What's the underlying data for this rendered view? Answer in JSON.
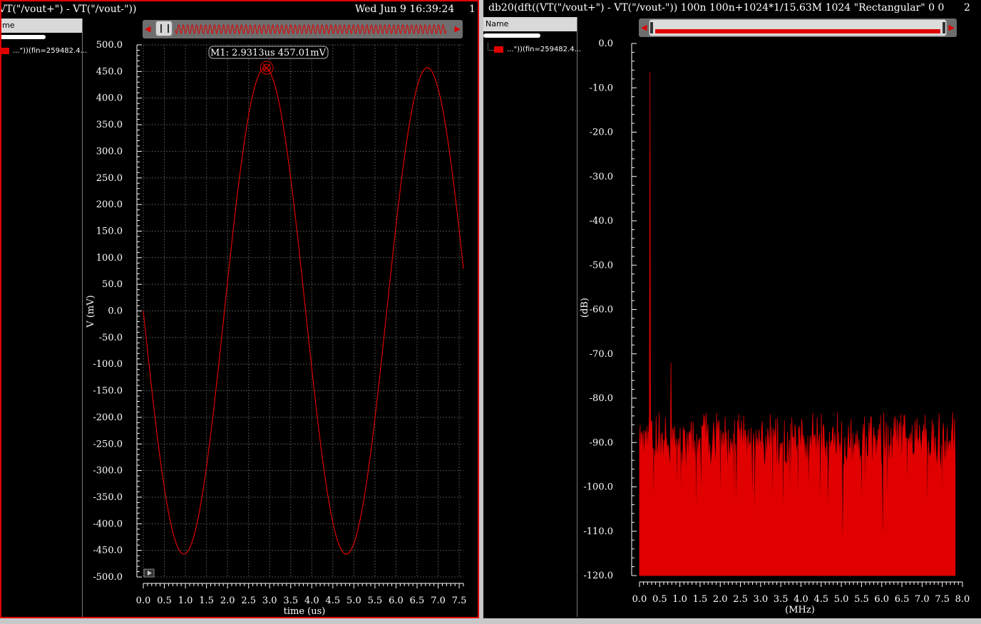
{
  "colors": {
    "trace": "#e00000",
    "grid": "#4a4a4a",
    "background": "#000000",
    "axis": "#ffffff"
  },
  "panel1": {
    "title": "VT(\"/vout+\") - VT(\"/vout-\"))",
    "date": "Wed Jun 9 16:39:24",
    "number": "1",
    "legend_header": "me",
    "legend_entry": "...\"))(fin=259482.4...",
    "marker_label": "M1: 2.9313us 457.01mV",
    "marker": {
      "x": 2.9313,
      "y": 457.01
    },
    "xlabel": "time (us)",
    "ylabel": "V (mV)"
  },
  "panel2": {
    "title": "db20(dft((VT(\"/vout+\") - VT(\"/vout-\"))  100n 100n+1024*1/15.63M 1024 \"Rectangular\" 0 0",
    "number": "2",
    "legend_header": "Name",
    "legend_entry": "...\"))(fin=259482.4...",
    "xlabel": "(MHz)",
    "ylabel": "(dB)"
  },
  "chart_data": [
    {
      "type": "line",
      "xlabel": "time (us)",
      "ylabel": "V (mV)",
      "xlim": [
        0,
        7.6
      ],
      "ylim": [
        -500,
        500
      ],
      "xticks": [
        "0.0",
        "0.5",
        "1.0",
        "1.5",
        "2.0",
        "2.5",
        "3.0",
        "3.5",
        "4.0",
        "4.5",
        "5.0",
        "5.5",
        "6.0",
        "6.5",
        "7.0",
        "7.5"
      ],
      "yticks": [
        "500.0",
        "450.0",
        "400.0",
        "350.0",
        "300.0",
        "250.0",
        "200.0",
        "150.0",
        "100.0",
        "50.0",
        "0.0",
        "-50.0",
        "-100.0",
        "-150.0",
        "-200.0",
        "-250.0",
        "-300.0",
        "-350.0",
        "-400.0",
        "-450.0",
        "-500.0"
      ],
      "grid": true,
      "series": [
        {
          "name": "...\"))(fin=259482.4...",
          "x": [
            0,
            0.964,
            2.93,
            4.86,
            6.78,
            7.6
          ],
          "y": [
            0,
            -457,
            457,
            -457,
            457,
            165
          ],
          "amplitude": 457,
          "frequency_mhz": 0.2595
        }
      ]
    },
    {
      "type": "line",
      "xlabel": "(MHz)",
      "ylabel": "(dB)",
      "xlim": [
        0,
        8.0
      ],
      "ylim": [
        -120,
        0
      ],
      "xticks": [
        "0.0",
        "0.5",
        "1.0",
        "1.5",
        "2.0",
        "2.5",
        "3.0",
        "3.5",
        "4.0",
        "4.5",
        "5.0",
        "5.5",
        "6.0",
        "6.5",
        "7.0",
        "7.5",
        "8.0"
      ],
      "yticks": [
        "0.0",
        "-10.0",
        "-20.0",
        "-30.0",
        "-40.0",
        "-50.0",
        "-60.0",
        "-70.0",
        "-80.0",
        "-90.0",
        "-100.0",
        "-110.0",
        "-120.0"
      ],
      "grid": false,
      "series": [
        {
          "name": "...\"))(fin=259482.4...",
          "fundamental": {
            "x": 0.26,
            "y": -6.5
          },
          "spur": {
            "x": 0.78,
            "y": -72
          },
          "noise_floor": [
            -110,
            -85
          ],
          "fill_to": -120
        }
      ]
    }
  ]
}
